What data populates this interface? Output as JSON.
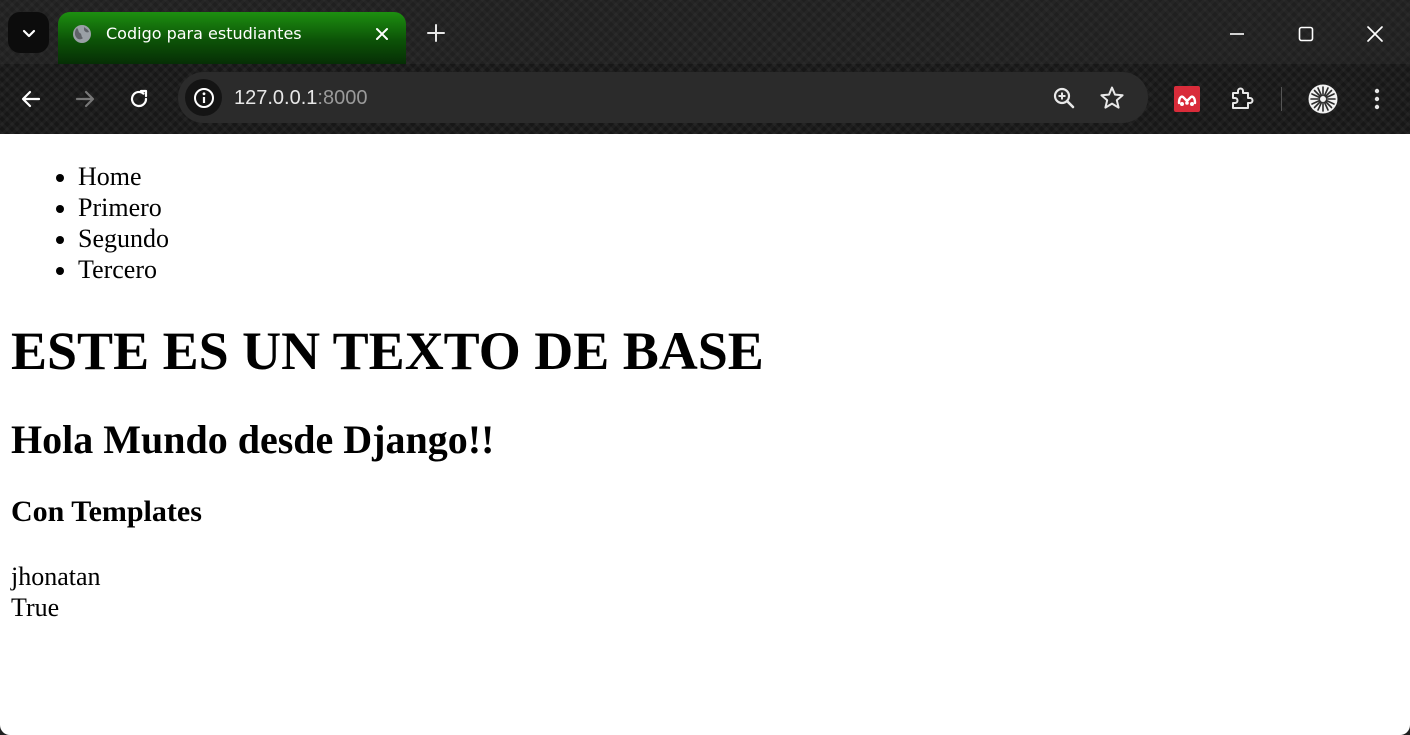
{
  "browser": {
    "tab": {
      "title": "Codigo para estudiantes",
      "favicon": "globe-icon"
    },
    "address_bar": {
      "host": "127.0.0.1",
      "port": ":8000"
    },
    "theme": {
      "tab_accent": "#1d8f10",
      "chrome_bg": "#202020",
      "omnibox_bg": "#2b2b2b"
    }
  },
  "page": {
    "nav": [
      "Home",
      "Primero",
      "Segundo",
      "Tercero"
    ],
    "heading1": "ESTE ES UN TEXTO DE BASE",
    "heading2": "Hola Mundo desde Django!!",
    "heading3": "Con Templates",
    "line1": "jhonatan",
    "line2": "True"
  }
}
